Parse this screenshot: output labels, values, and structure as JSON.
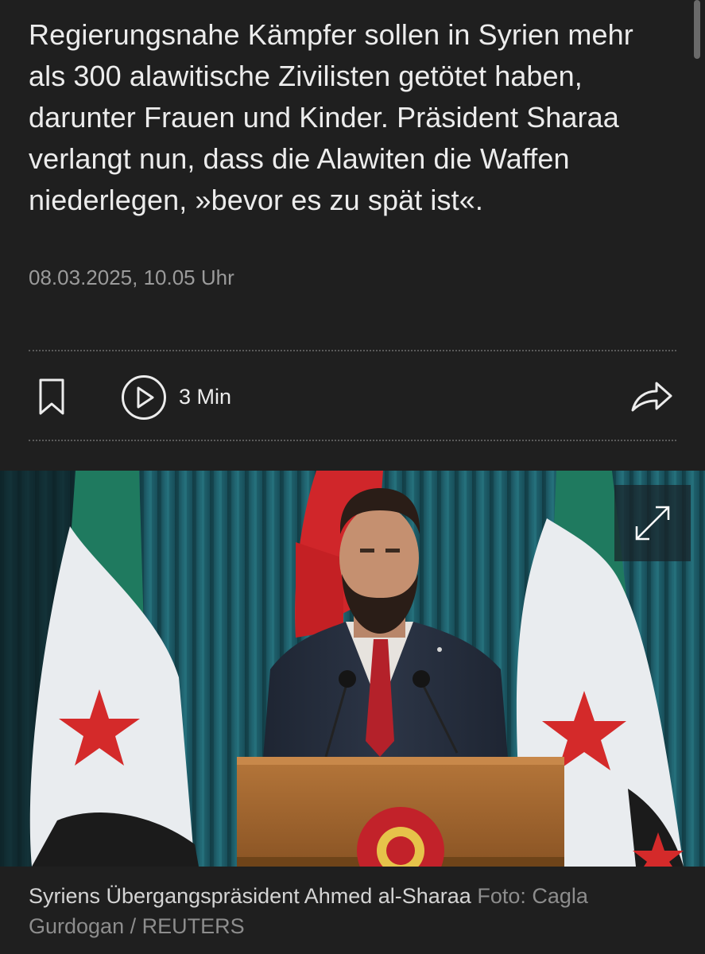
{
  "article": {
    "teaser_lines": [
      "Regierungsnahe Kämpfer sollen in Syrien mehr",
      "als 300 alawitische Zivilisten getötet haben,",
      "darunter Frauen und Kinder. Präsident Sharaa",
      "verlangt nun, dass die Alawiten die Waffen",
      "niederlegen, »bevor es zu spät ist«."
    ],
    "dateline": "08.03.2025, 10.05 Uhr"
  },
  "actions": {
    "bookmark_icon": "bookmark-icon",
    "play_icon": "play-circle-icon",
    "audio_duration": "3 Min",
    "share_icon": "share-arrow-icon"
  },
  "image": {
    "expand_icon": "expand-arrows-icon",
    "caption": "Syriens Übergangspräsident Ahmed al-Sharaa",
    "credit_line1": "Foto: Cagla",
    "credit_line2": "Gurdogan / REUTERS"
  },
  "colors": {
    "background": "#1f1f1f",
    "text": "#ececec",
    "muted": "#9b9b9b",
    "flag_green": "#1f7a5f",
    "flag_red": "#d42a2a"
  }
}
